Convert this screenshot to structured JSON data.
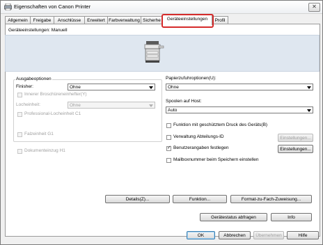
{
  "window": {
    "title": "Eigenschaften von Canon Printer",
    "close_glyph": "✕"
  },
  "tabs": [
    {
      "label": "Allgemein"
    },
    {
      "label": "Freigabe"
    },
    {
      "label": "Anschlüsse"
    },
    {
      "label": "Erweitert"
    },
    {
      "label": "Farbverwaltung"
    },
    {
      "label": "Sicherhe"
    },
    {
      "label": "Geräteeinstellungen"
    },
    {
      "label": "Profil"
    }
  ],
  "settings_label": "Geräteeinstellungen: Manuell",
  "output": {
    "group_label": "Ausgabeoptionen",
    "finisher_label": "Finisher:",
    "finisher_value": "Ohne",
    "booklet_label": "Innerer Broschüreneinhefter(Y)",
    "puncher_label": "Locheinheit:",
    "puncher_value": "Ohne",
    "prof_puncher_label": "Professional-Locheinheit C1",
    "folding_label": "Falzeinheit G1"
  },
  "doc_feeder_label": "Dokumenteinzug H1",
  "paper_feed": {
    "label": "Papierzufuhroptionen(U):",
    "value": "Ohne"
  },
  "spool": {
    "label": "Spoolen auf Host:",
    "value": "Auto"
  },
  "options": [
    {
      "label": "Funktion mit geschütztem Druck des Geräts(B)",
      "checked": false
    },
    {
      "label": "Verwaltung Abteilungs-ID",
      "checked": false,
      "button": "Einstellungen...",
      "button_enabled": false
    },
    {
      "label": "Benutzerangaben festlegen",
      "checked": true,
      "button": "Einstellungen...",
      "button_enabled": true
    },
    {
      "label": "Mailboxnummer beim Speichern einstellen",
      "checked": false
    }
  ],
  "buttons": {
    "details": "Details(Z)...",
    "function": "Funktion...",
    "format_mapping": "Format-zu-Fach-Zuweisung...",
    "query_status": "Gerätestatus abfragen",
    "info": "Info",
    "ok": "OK",
    "cancel": "Abbrechen",
    "apply": "Übernehmen",
    "help": "Hilfe"
  },
  "check_glyph": "✓"
}
